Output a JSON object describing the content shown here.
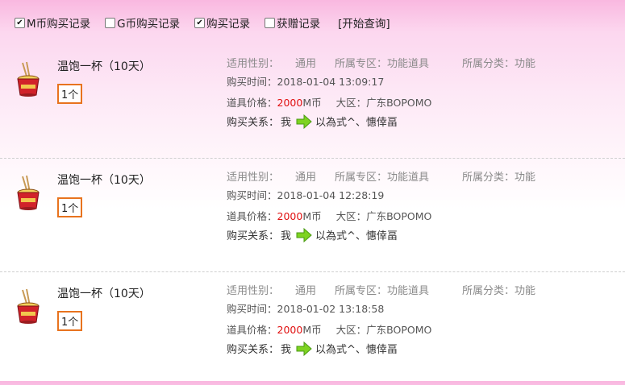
{
  "filters": [
    {
      "label": "M币购买记录",
      "checked": true
    },
    {
      "label": "G币购买记录",
      "checked": false
    },
    {
      "label": "购买记录",
      "checked": true
    },
    {
      "label": "获赠记录",
      "checked": false
    }
  ],
  "query_button": "[开始查询]",
  "labels": {
    "gender": "适用性别：",
    "zone": "所属专区：",
    "category": "所属分类：",
    "time": "购买时间：",
    "price": "道具价格：",
    "server": "大区：",
    "relation": "购买关系：",
    "currency": "M币"
  },
  "icons": {
    "item": "noodle-cup-icon",
    "arrow": "green-right-arrow-icon"
  },
  "colors": {
    "accent": "#e8731e",
    "price": "#e01010",
    "arrow": "#7ed321"
  },
  "records": [
    {
      "name": "温饱一杯（10天）",
      "qty": "1个",
      "gender": "通用",
      "zone": "功能道具",
      "category": "功能",
      "time": "2018-01-04 13:09:17",
      "price": "2000",
      "server": "广东BOPOMO",
      "buyer": "我",
      "recipient": "以為式^、憓倖畐"
    },
    {
      "name": "温饱一杯（10天）",
      "qty": "1个",
      "gender": "通用",
      "zone": "功能道具",
      "category": "功能",
      "time": "2018-01-04 12:28:19",
      "price": "2000",
      "server": "广东BOPOMO",
      "buyer": "我",
      "recipient": "以為式^、憓倖畐"
    },
    {
      "name": "温饱一杯（10天）",
      "qty": "1个",
      "gender": "通用",
      "zone": "功能道具",
      "category": "功能",
      "time": "2018-01-02 13:18:58",
      "price": "2000",
      "server": "广东BOPOMO",
      "buyer": "我",
      "recipient": "以為式^、憓倖畐"
    }
  ]
}
